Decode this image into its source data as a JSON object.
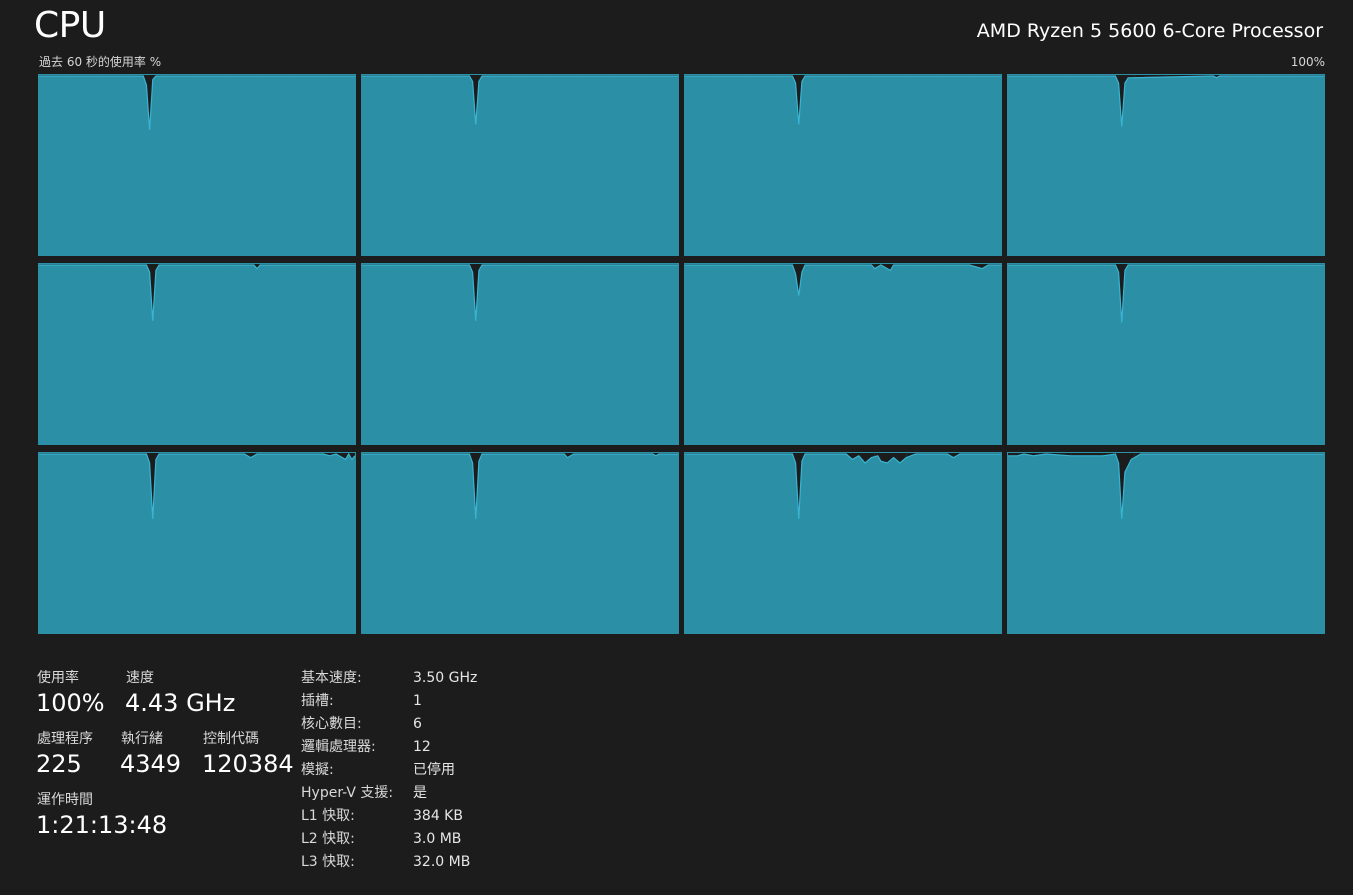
{
  "header": {
    "title": "CPU",
    "processor_name": "AMD Ryzen 5 5600 6-Core Processor",
    "graph_caption": "過去 60 秒的使用率 %",
    "graph_max": "100%"
  },
  "colors": {
    "background": "#1c1c1c",
    "graph_fill": "#2b8fa6",
    "graph_line": "#3ab4d2",
    "grid_line": "#2c7f94"
  },
  "chart_data": {
    "type": "area",
    "title": "過去 60 秒的使用率 %",
    "ylim": [
      0,
      100
    ],
    "ymax_label": "100%",
    "series": [
      {
        "dips": [
          [
            0,
            100
          ],
          [
            33,
            100
          ],
          [
            34,
            95
          ],
          [
            35,
            70
          ],
          [
            36,
            98
          ],
          [
            37,
            100
          ],
          [
            100,
            100
          ]
        ]
      },
      {
        "dips": [
          [
            0,
            100
          ],
          [
            34,
            100
          ],
          [
            35,
            97
          ],
          [
            36,
            73
          ],
          [
            37,
            97
          ],
          [
            38,
            100
          ],
          [
            100,
            100
          ]
        ]
      },
      {
        "dips": [
          [
            0,
            100
          ],
          [
            34,
            100
          ],
          [
            35,
            96
          ],
          [
            36,
            73
          ],
          [
            37,
            97
          ],
          [
            38,
            100
          ],
          [
            100,
            100
          ]
        ]
      },
      {
        "dips": [
          [
            0,
            100
          ],
          [
            34,
            100
          ],
          [
            35,
            96
          ],
          [
            36,
            72
          ],
          [
            37,
            96
          ],
          [
            38,
            99
          ],
          [
            65,
            100
          ],
          [
            66,
            99
          ],
          [
            67,
            100
          ],
          [
            100,
            100
          ]
        ]
      },
      {
        "dips": [
          [
            0,
            100
          ],
          [
            34,
            100
          ],
          [
            35,
            96
          ],
          [
            36,
            69
          ],
          [
            37,
            97
          ],
          [
            38,
            100
          ],
          [
            68,
            100
          ],
          [
            69,
            98
          ],
          [
            70,
            100
          ],
          [
            100,
            100
          ]
        ]
      },
      {
        "dips": [
          [
            0,
            100
          ],
          [
            34,
            100
          ],
          [
            35,
            96
          ],
          [
            36,
            69
          ],
          [
            37,
            97
          ],
          [
            38,
            100
          ],
          [
            100,
            100
          ]
        ]
      },
      {
        "dips": [
          [
            0,
            100
          ],
          [
            34,
            100
          ],
          [
            35,
            95
          ],
          [
            36,
            83
          ],
          [
            37,
            96
          ],
          [
            38,
            100
          ],
          [
            59,
            100
          ],
          [
            60,
            98
          ],
          [
            62,
            100
          ],
          [
            65,
            97
          ],
          [
            66,
            100
          ],
          [
            90,
            100
          ],
          [
            94,
            98
          ],
          [
            96,
            100
          ],
          [
            100,
            100
          ]
        ]
      },
      {
        "dips": [
          [
            0,
            100
          ],
          [
            34,
            100
          ],
          [
            35,
            96
          ],
          [
            36,
            68
          ],
          [
            37,
            97
          ],
          [
            38,
            100
          ],
          [
            100,
            100
          ]
        ]
      },
      {
        "dips": [
          [
            0,
            100
          ],
          [
            34,
            100
          ],
          [
            35,
            95
          ],
          [
            36,
            64
          ],
          [
            37,
            97
          ],
          [
            38,
            100
          ],
          [
            65,
            100
          ],
          [
            67,
            98
          ],
          [
            69,
            100
          ],
          [
            90,
            100
          ],
          [
            92,
            99
          ],
          [
            94,
            100
          ],
          [
            97,
            97
          ],
          [
            98,
            100
          ],
          [
            99,
            97
          ],
          [
            100,
            99
          ]
        ]
      },
      {
        "dips": [
          [
            0,
            100
          ],
          [
            34,
            100
          ],
          [
            35,
            95
          ],
          [
            36,
            64
          ],
          [
            37,
            96
          ],
          [
            38,
            100
          ],
          [
            64,
            100
          ],
          [
            65,
            98
          ],
          [
            67,
            100
          ],
          [
            92,
            100
          ],
          [
            93,
            99
          ],
          [
            94,
            100
          ],
          [
            100,
            100
          ]
        ]
      },
      {
        "dips": [
          [
            0,
            100
          ],
          [
            34,
            100
          ],
          [
            35,
            95
          ],
          [
            36,
            64
          ],
          [
            37,
            96
          ],
          [
            38,
            100
          ],
          [
            51,
            100
          ],
          [
            53,
            97
          ],
          [
            55,
            99
          ],
          [
            57,
            95
          ],
          [
            59,
            98
          ],
          [
            61,
            99
          ],
          [
            62,
            96
          ],
          [
            64,
            95
          ],
          [
            66,
            98
          ],
          [
            68,
            95
          ],
          [
            70,
            98
          ],
          [
            73,
            100
          ],
          [
            83,
            100
          ],
          [
            85,
            98
          ],
          [
            87,
            100
          ],
          [
            100,
            100
          ]
        ]
      },
      {
        "dips": [
          [
            0,
            99
          ],
          [
            3,
            99
          ],
          [
            5,
            100
          ],
          [
            8,
            99
          ],
          [
            12,
            100
          ],
          [
            20,
            99
          ],
          [
            30,
            99
          ],
          [
            34,
            100
          ],
          [
            35,
            95
          ],
          [
            36,
            64
          ],
          [
            37,
            90
          ],
          [
            39,
            97
          ],
          [
            42,
            100
          ],
          [
            100,
            100
          ]
        ]
      }
    ]
  },
  "stats": {
    "usage_label": "使用率",
    "usage_value": "100%",
    "speed_label": "速度",
    "speed_value": "4.43 GHz",
    "processes_label": "處理程序",
    "processes_value": "225",
    "threads_label": "執行緒",
    "threads_value": "4349",
    "handles_label": "控制代碼",
    "handles_value": "120384",
    "uptime_label": "運作時間",
    "uptime_value": "1:21:13:48"
  },
  "specs": [
    {
      "label": "基本速度:",
      "value": "3.50 GHz"
    },
    {
      "label": "插槽:",
      "value": "1"
    },
    {
      "label": "核心數目:",
      "value": "6"
    },
    {
      "label": "邏輯處理器:",
      "value": "12"
    },
    {
      "label": "模擬:",
      "value": "已停用"
    },
    {
      "label": "Hyper-V 支援:",
      "value": "是"
    },
    {
      "label": "L1 快取:",
      "value": "384 KB"
    },
    {
      "label": "L2 快取:",
      "value": "3.0 MB"
    },
    {
      "label": "L3 快取:",
      "value": "32.0 MB"
    }
  ]
}
